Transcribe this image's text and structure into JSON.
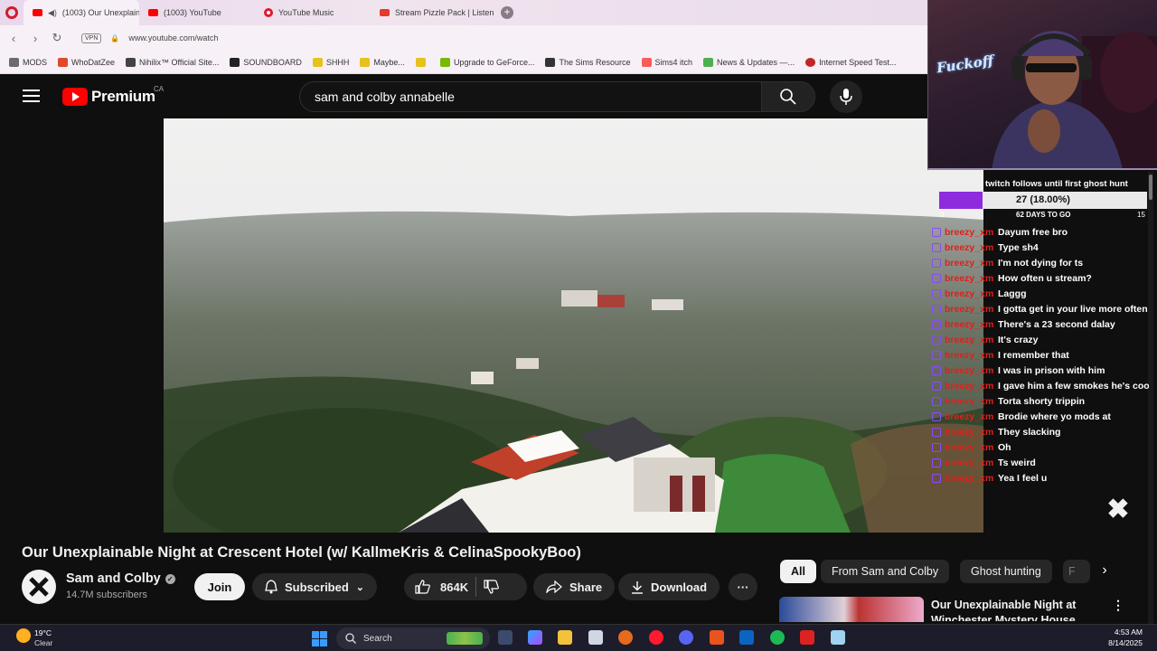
{
  "browser": {
    "tabs": [
      {
        "label": "(1003) Our Unexplaina",
        "active": true
      },
      {
        "label": "(1003) YouTube",
        "active": false
      },
      {
        "label": "YouTube Music",
        "active": false
      },
      {
        "label": "Stream Pizzle Pack | Listen",
        "active": false
      }
    ],
    "new_tab_symbol": "+",
    "vpn_label": "VPN",
    "url": "www.youtube.com/watch",
    "bookmarks": [
      "MODS",
      "WhoDatZee",
      "Nihilix™ Official Site...",
      "SOUNDBOARD",
      "SHHH",
      "Maybe...",
      "",
      "Upgrade to GeForce...",
      "The Sims Resource",
      "Sims4 itch",
      "News & Updates —...",
      "Internet Speed Test..."
    ]
  },
  "youtube": {
    "logo_text": "Premium",
    "country": "CA",
    "search_query": "sam and colby annabelle",
    "video_title": "Our Unexplainable Night at Crescent Hotel (w/ KallmeKris & CelinaSpookyBoo)",
    "channel_name": "Sam and Colby",
    "verified_mark": "✓",
    "subscribers": "14.7M subscribers",
    "join_label": "Join",
    "subscribed_label": "Subscribed",
    "like_count": "864K",
    "share_label": "Share",
    "download_label": "Download",
    "more_label": "···",
    "chips": [
      "All",
      "From Sam and Colby",
      "Ghost hunting",
      "F"
    ],
    "recommended_title": "Our Unexplainable Night at Winchester Mystery House"
  },
  "stream": {
    "cam_logo": "Fuckoff",
    "goal_label": "twitch follows until first ghost hunt",
    "goal_text": "27 (18.00%)",
    "goal_fraction": 0.18,
    "goal_min": "0",
    "goal_days": "62 DAYS TO GO",
    "goal_max": "15",
    "chat": [
      {
        "user": "breezy_xm",
        "msg": "Dayum free bro"
      },
      {
        "user": "breezy_xm",
        "msg": "Type sh4"
      },
      {
        "user": "breezy_xm",
        "msg": "I'm not dying for ts"
      },
      {
        "user": "breezy_xm",
        "msg": "How often u stream?"
      },
      {
        "user": "breezy_xm",
        "msg": "Laggg"
      },
      {
        "user": "breezy_xm",
        "msg": "I gotta get in your live more often"
      },
      {
        "user": "breezy_xm",
        "msg": "There's a 23 second dalay"
      },
      {
        "user": "breezy_xm",
        "msg": "It's crazy"
      },
      {
        "user": "breezy_xm",
        "msg": "I remember that"
      },
      {
        "user": "breezy_xm",
        "msg": "I was in prison with him"
      },
      {
        "user": "breezy_xm",
        "msg": "I gave him a few smokes he's cool"
      },
      {
        "user": "breezy_xm",
        "msg": "Torta shorty trippin"
      },
      {
        "user": "breezy_xm",
        "msg": "Brodie where yo mods at"
      },
      {
        "user": "breezy_xm",
        "msg": "They slacking"
      },
      {
        "user": "breezy_xm",
        "msg": "Oh"
      },
      {
        "user": "breezy_xm",
        "msg": "Ts weird"
      },
      {
        "user": "breezy_xm",
        "msg": "Yea I feel u"
      }
    ],
    "close_symbol": "✖"
  },
  "taskbar": {
    "temperature": "19°C",
    "condition": "Clear",
    "search_label": "Search",
    "time": "4:53 AM",
    "date": "8/14/2025"
  },
  "colors": {
    "yt_red": "#ff0000",
    "twitch_purple": "#8e2bdc",
    "chat_user": "#e0201a"
  }
}
